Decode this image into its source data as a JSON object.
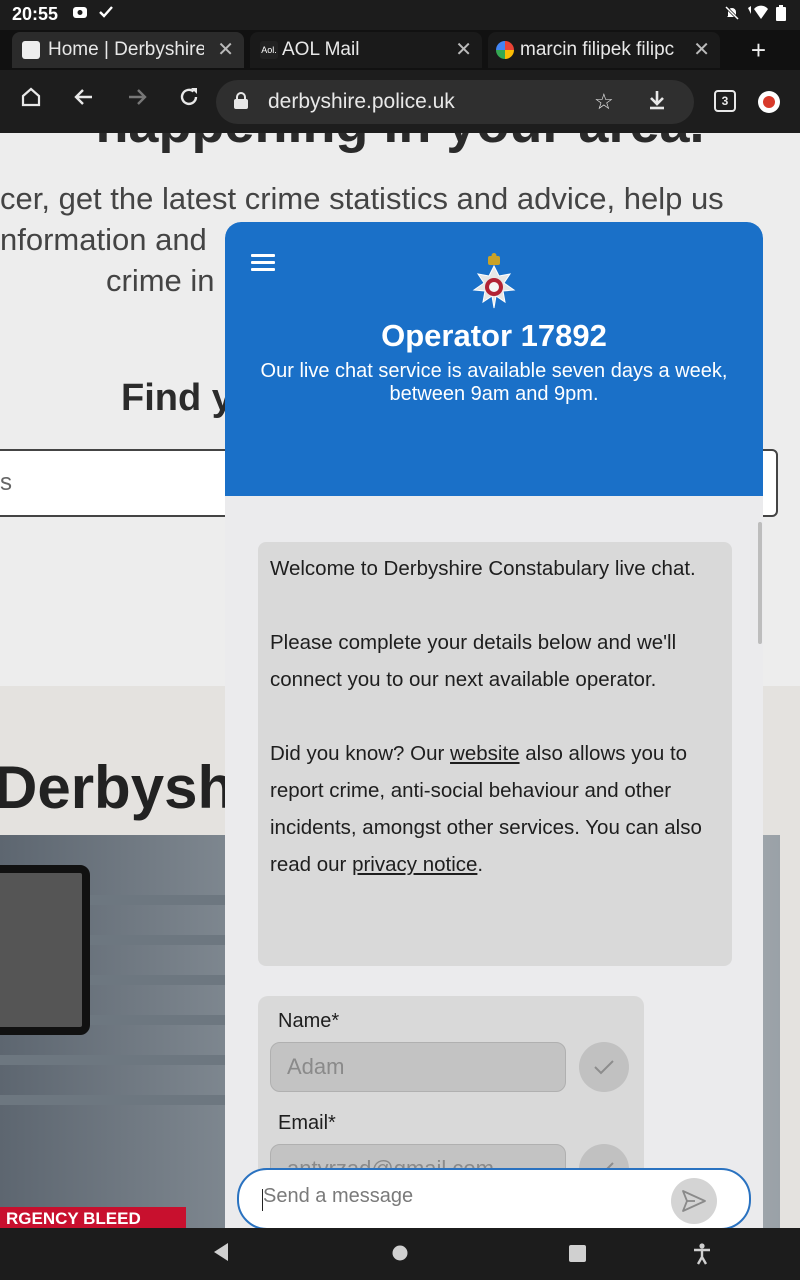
{
  "status_bar": {
    "time": "20:55"
  },
  "browser": {
    "tabs": [
      {
        "label": "Home | Derbyshire"
      },
      {
        "label": "AOL Mail"
      },
      {
        "label": "marcin filipek filipc"
      }
    ],
    "url": "derbyshire.police.uk",
    "tab_count": "3"
  },
  "page": {
    "heading_partial": "happening in your area.",
    "intro_lines": [
      "cer, get the latest crime statistics and advice, help us",
      "nformation and",
      "crime in"
    ],
    "find_heading": "Find y",
    "search_placeholder": "s",
    "section_title": "Derbyshi",
    "photo_caption": "RGENCY BLEED"
  },
  "chat": {
    "operator": "Operator 17892",
    "availability": "Our live chat service is available seven days a week, between 9am and 9pm.",
    "welcome": {
      "line1": "Welcome to Derbyshire Constabulary live chat.",
      "line2": "Please complete your details below and we'll connect you to our next available operator.",
      "did_you_know_prefix": "Did you know? Our ",
      "website_link": "website",
      "did_you_know_middle": " also allows you to report crime, anti-social behaviour and other incidents, amongst other services. You can also read our ",
      "privacy_link": "privacy notice",
      "suffix": "."
    },
    "form": {
      "name_label": "Name*",
      "name_value": "Adam",
      "email_label": "Email*",
      "email_value": "antyrzad@gmail.com"
    },
    "message_placeholder": "Send a message"
  },
  "colors": {
    "header_blue": "#1a70c8",
    "composer_border": "#2a72c0"
  }
}
